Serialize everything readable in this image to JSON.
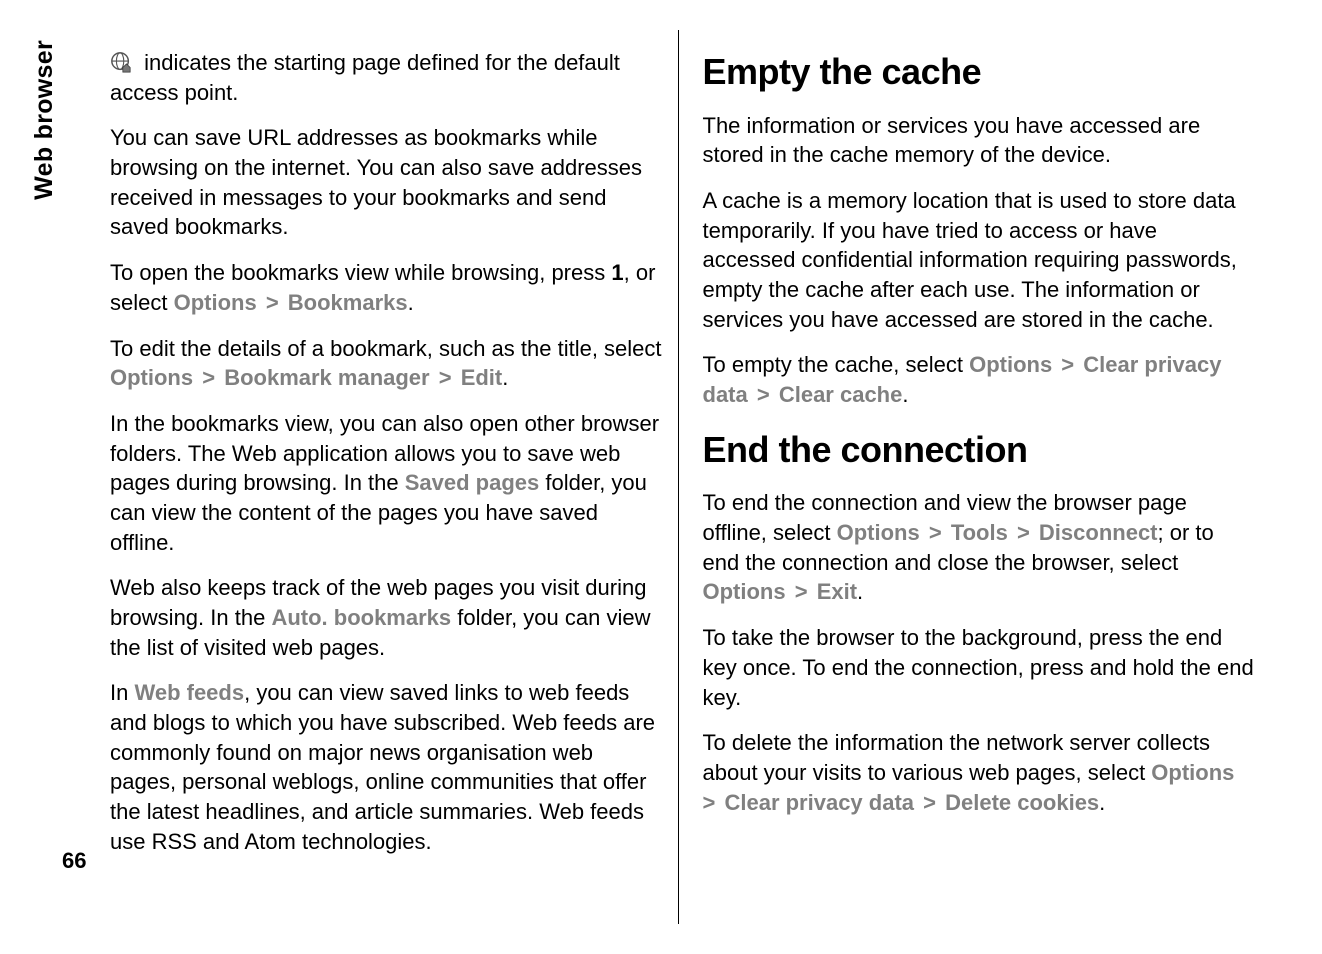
{
  "sideTab": "Web browser",
  "pageNumber": "66",
  "left": {
    "p1_after_icon": " indicates the starting page defined for the default access point.",
    "p2": "You can save URL addresses as bookmarks while browsing on the internet. You can also save addresses received in messages to your bookmarks and send saved bookmarks.",
    "p3_a": "To open the bookmarks view while browsing, press ",
    "p3_b_key": "1",
    "p3_c": ", or select ",
    "p3_opt": "Options",
    "p3_bm": "Bookmarks",
    "p3_end": ".",
    "p4_a": "To edit the details of a bookmark, such as the title, select ",
    "p4_opt": "Options",
    "p4_bm_mgr": "Bookmark manager",
    "p4_edit": "Edit",
    "p4_end": ".",
    "p5_a": "In the bookmarks view, you can also open other browser folders. The Web application allows you to save web pages during browsing. In the ",
    "p5_saved": "Saved pages",
    "p5_b": " folder, you can view the content of the pages you have saved offline.",
    "p6_a": "Web also keeps track of the web pages you visit during browsing. In the ",
    "p6_auto": "Auto. bookmarks",
    "p6_b": " folder, you can view the list of visited web pages.",
    "p7_a": "In ",
    "p7_feeds": "Web feeds",
    "p7_b": ", you can view saved links to web feeds and blogs to which you have subscribed. Web feeds are commonly found on major news organisation web pages, personal weblogs, online communities that offer the latest headlines, and article summaries. Web feeds use RSS and Atom technologies."
  },
  "right": {
    "h_cache": "Empty the cache",
    "c1": "The information or services you have accessed are stored in the cache memory of the device.",
    "c2": "A cache is a memory location that is used to store data temporarily. If you have tried to access or have accessed confidential information requiring passwords, empty the cache after each use. The information or services you have accessed are stored in the cache.",
    "c3_a": "To empty the cache, select ",
    "c3_opt": "Options",
    "c3_cpd": "Clear privacy data",
    "c3_cc": "Clear cache",
    "c3_end": ".",
    "h_end": "End the connection",
    "e1_a": "To end the connection and view the browser page offline, select ",
    "e1_opt": "Options",
    "e1_tools": "Tools",
    "e1_disc": "Disconnect",
    "e1_b": "; or to end the connection and close the browser, select ",
    "e1_opt2": "Options",
    "e1_exit": "Exit",
    "e1_end": ".",
    "e2": "To take the browser to the background, press the end key once. To end the connection, press and hold the end key.",
    "e3_a": "To delete the information the network server collects about your visits to various web pages, select ",
    "e3_opt": "Options",
    "e3_cpd": "Clear privacy data",
    "e3_dc": "Delete cookies",
    "e3_end": "."
  }
}
